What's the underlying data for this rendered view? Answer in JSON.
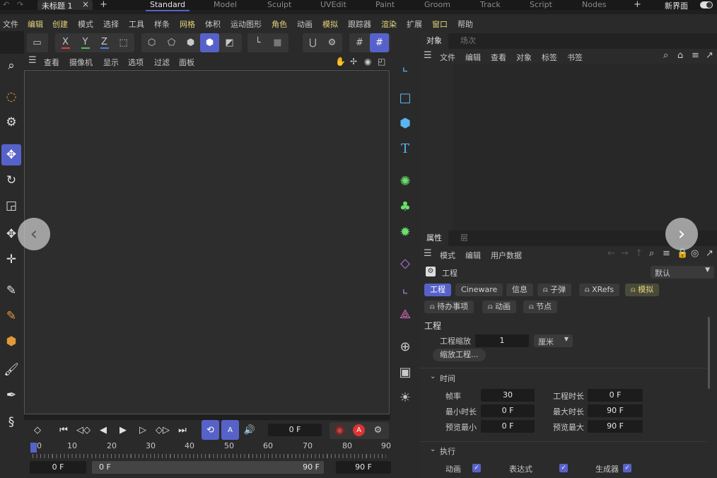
{
  "titlebar": {
    "doc_tab": "未标题 1",
    "close": "×",
    "plus": "+",
    "layouts": [
      "Standard",
      "Model",
      "Sculpt",
      "UVEdit",
      "Paint",
      "Groom",
      "Track",
      "Script",
      "Nodes"
    ],
    "add_layout": "+",
    "new_ui": "新界面"
  },
  "menu": [
    "文件",
    "编辑",
    "创建",
    "模式",
    "选择",
    "工具",
    "样条",
    "网格",
    "体积",
    "运动图形",
    "角色",
    "动画",
    "模拟",
    "跟踪器",
    "渲染",
    "扩展",
    "窗口",
    "帮助"
  ],
  "axis": {
    "x": "X",
    "y": "Y",
    "z": "Z"
  },
  "viewport_menu": [
    "查看",
    "摄像机",
    "显示",
    "选项",
    "过滤",
    "面板"
  ],
  "objects_panel": {
    "tabs": [
      "对象",
      "场次"
    ],
    "menu": [
      "文件",
      "编辑",
      "查看",
      "对象",
      "标签",
      "书签"
    ]
  },
  "attributes_panel": {
    "tabs": [
      "属性",
      "层"
    ],
    "menu": [
      "模式",
      "编辑",
      "用户数据"
    ],
    "object_name": "工程",
    "preset": "默认",
    "chips_row1": [
      "工程",
      "Cineware",
      "信息",
      "子弹",
      "XRefs",
      "模拟"
    ],
    "chips_row2": [
      "待办事项",
      "动画",
      "节点"
    ],
    "section_title": "工程",
    "scale_label": "工程缩放",
    "scale_value": "1",
    "scale_unit": "厘米",
    "scale_button": "缩放工程...",
    "time_section": "时间",
    "fps_label": "帧率",
    "fps_value": "30",
    "duration_label": "工程时长",
    "duration_value": "0 F",
    "min_label": "最小时长",
    "min_value": "0 F",
    "max_label": "最大时长",
    "max_value": "90 F",
    "pmin_label": "预览最小",
    "pmin_value": "0 F",
    "pmax_label": "预览最大",
    "pmax_value": "90 F",
    "exec_section": "执行",
    "anim_label": "动画",
    "expr_label": "表达式",
    "gen_label": "生成器"
  },
  "timeline": {
    "current_frame": "0 F",
    "ticks": [
      "0",
      "10",
      "20",
      "30",
      "40",
      "50",
      "60",
      "70",
      "80",
      "90"
    ],
    "start": "0 F",
    "range_start": "0 F",
    "range_end": "90 F",
    "end": "90 F"
  },
  "colors": {
    "accent": "#5762c9",
    "x_axis": "#e04040",
    "y_axis": "#4fc04f",
    "z_axis": "#4a7fe0",
    "warn": "#e2d27a"
  }
}
